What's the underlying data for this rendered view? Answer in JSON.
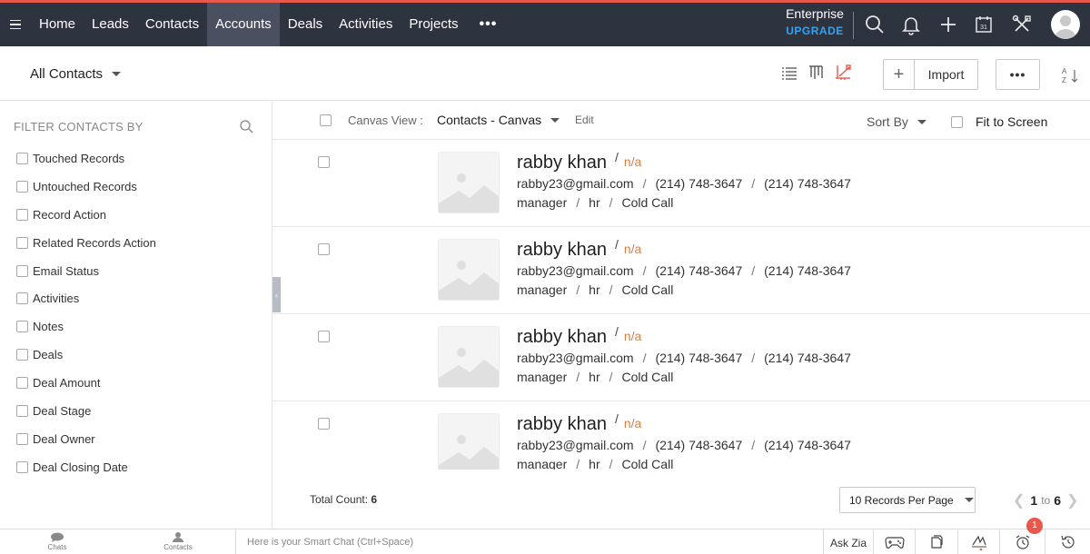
{
  "nav": {
    "tabs": [
      {
        "label": "Home"
      },
      {
        "label": "Leads"
      },
      {
        "label": "Contacts"
      },
      {
        "label": "Accounts",
        "active": true
      },
      {
        "label": "Deals"
      },
      {
        "label": "Activities"
      },
      {
        "label": "Projects"
      }
    ],
    "more_label": "•••",
    "plan": "Enterprise",
    "upgrade": "UPGRADE",
    "icons": [
      "search-icon",
      "bell-icon",
      "plus-icon",
      "calendar-icon",
      "tools-icon"
    ],
    "calendar_day": "31",
    "accent": "#e8574b",
    "bg": "#2e3340"
  },
  "subheader": {
    "view_name": "All Contacts",
    "import_plus": "+",
    "import_label": "Import",
    "more_label": "•••"
  },
  "sidebar": {
    "title": "FILTER CONTACTS BY",
    "filters": [
      "Touched Records",
      "Untouched Records",
      "Record Action",
      "Related Records Action",
      "Email Status",
      "Activities",
      "Notes",
      "Deals",
      "Deal Amount",
      "Deal Stage",
      "Deal Owner",
      "Deal Closing Date"
    ],
    "collapse_glyph": "‹"
  },
  "canvas": {
    "view_label": "Canvas View :",
    "view_name": "Contacts - Canvas",
    "edit_label": "Edit",
    "sort_label": "Sort By",
    "fit_label": "Fit to Screen"
  },
  "records": [
    {
      "name": "rabby khan",
      "slash": "/",
      "na": "n/a",
      "email": "rabby23@gmail.com",
      "phone1": "(214) 748-3647",
      "phone2": "(214) 748-3647",
      "title": "manager",
      "dept": "hr",
      "source": "Cold Call"
    },
    {
      "name": "rabby khan",
      "slash": "/",
      "na": "n/a",
      "email": "rabby23@gmail.com",
      "phone1": "(214) 748-3647",
      "phone2": "(214) 748-3647",
      "title": "manager",
      "dept": "hr",
      "source": "Cold Call"
    },
    {
      "name": "rabby khan",
      "slash": "/",
      "na": "n/a",
      "email": "rabby23@gmail.com",
      "phone1": "(214) 748-3647",
      "phone2": "(214) 748-3647",
      "title": "manager",
      "dept": "hr",
      "source": "Cold Call"
    },
    {
      "name": "rabby khan",
      "slash": "/",
      "na": "n/a",
      "email": "rabby23@gmail.com",
      "phone1": "(214) 748-3647",
      "phone2": "(214) 748-3647",
      "title": "manager",
      "dept": "hr",
      "source": "Cold Call"
    }
  ],
  "record_separator": "/",
  "footer": {
    "total_label": "Total Count:",
    "total_value": "6",
    "per_page": "10 Records Per Page",
    "page_start": "1",
    "page_to": "to",
    "page_end": "6"
  },
  "bottombar": {
    "chats_label": "Chats",
    "contacts_label": "Contacts",
    "smartchat_placeholder": "Here is your Smart Chat (Ctrl+Space)",
    "askzia_label": "Ask Zia",
    "badge_count": "1"
  }
}
